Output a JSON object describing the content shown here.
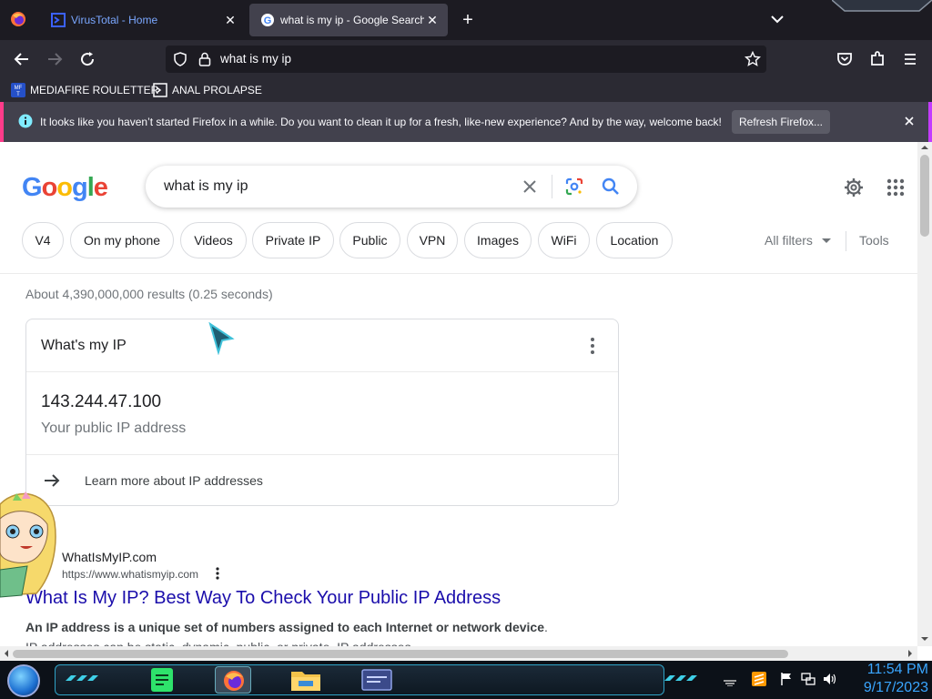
{
  "browser": {
    "tabs": [
      {
        "label": "VirusTotal - Home",
        "active": false
      },
      {
        "label": "what is my ip - Google Search",
        "active": true
      }
    ],
    "url": "what is my ip",
    "bookmarks": [
      "MEDIAFIRE ROULETTER",
      "ANAL PROLAPSE"
    ],
    "notification": {
      "message": "It looks like you haven’t started Firefox in a while. Do you want to clean it up for a fresh, like-new experience? And by the way, welcome back!",
      "button": "Refresh Firefox..."
    }
  },
  "google": {
    "query": "what is my ip",
    "chips": [
      "V4",
      "On my phone",
      "Videos",
      "Private IP",
      "Public",
      "VPN",
      "Images",
      "WiFi",
      "Location"
    ],
    "all_filters": "All filters",
    "tools": "Tools",
    "stats": "About 4,390,000,000 results (0.25 seconds)",
    "ip_card": {
      "heading": "What's my IP",
      "ip": "143.244.47.100",
      "caption": "Your public IP address",
      "learn_more": "Learn more about IP addresses"
    },
    "result": {
      "site_name": "WhatIsMyIP.com",
      "url": "https://www.whatismyip.com",
      "title": "What Is My IP? Best Way To Check Your Public IP Address",
      "snippet_bold": "An IP address is a unique set of numbers assigned to each Internet or network device",
      "snippet_rest": ". IP addresses can be static, dynamic, public, or private. IP addresses ..."
    }
  },
  "taskbar": {
    "time": "11:54 PM",
    "date": "9/17/2023"
  },
  "colors": {
    "link": "#1a0dab",
    "google_blue": "#4285f4",
    "google_red": "#ea4335",
    "google_yellow": "#fbbc05",
    "google_green": "#34a853"
  }
}
